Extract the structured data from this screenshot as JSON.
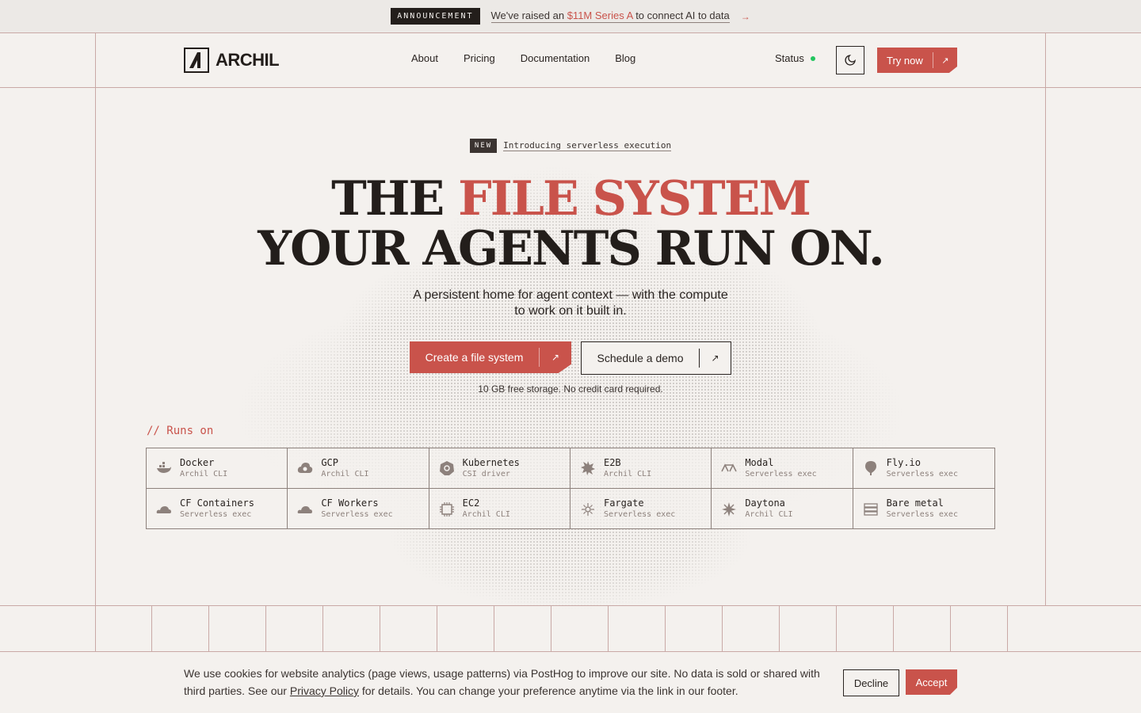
{
  "announcement": {
    "tag": "ANNOUNCEMENT",
    "pre": "We've raised an ",
    "highlight": "$11M Series A",
    "post": " to connect AI to data",
    "arrow": "→"
  },
  "brand": {
    "name": "ARCHIL"
  },
  "nav": {
    "items": [
      {
        "label": "About"
      },
      {
        "label": "Pricing"
      },
      {
        "label": "Documentation"
      },
      {
        "label": "Blog"
      }
    ],
    "status_label": "Status",
    "try_label": "Try now",
    "arrow": "↗"
  },
  "hero": {
    "new_tag": "NEW",
    "new_text": "Introducing serverless execution",
    "line1_pre": "THE ",
    "line1_red": "FILE SYSTEM",
    "line2": "YOUR AGENTS RUN ON.",
    "sub1": "A persistent home for agent context — with the compute",
    "sub2": "to work on it built in.",
    "cta_primary": "Create a file system",
    "cta_secondary": "Schedule a demo",
    "arrow": "↗",
    "free_note": "10 GB free storage. No credit card required."
  },
  "runs_on": {
    "label": "// Runs on",
    "items": [
      {
        "name": "Docker",
        "desc": "Archil CLI",
        "icon": "docker-icon"
      },
      {
        "name": "GCP",
        "desc": "Archil CLI",
        "icon": "cloud-icon"
      },
      {
        "name": "Kubernetes",
        "desc": "CSI driver",
        "icon": "kubernetes-icon"
      },
      {
        "name": "E2B",
        "desc": "Archil CLI",
        "icon": "e2b-icon"
      },
      {
        "name": "Modal",
        "desc": "Serverless exec",
        "icon": "modal-icon"
      },
      {
        "name": "Fly.io",
        "desc": "Serverless exec",
        "icon": "balloon-icon"
      },
      {
        "name": "CF Containers",
        "desc": "Serverless exec",
        "icon": "cloudflare-icon"
      },
      {
        "name": "CF Workers",
        "desc": "Serverless exec",
        "icon": "cloudflare-icon"
      },
      {
        "name": "EC2",
        "desc": "Archil CLI",
        "icon": "chip-icon"
      },
      {
        "name": "Fargate",
        "desc": "Serverless exec",
        "icon": "fargate-icon"
      },
      {
        "name": "Daytona",
        "desc": "Archil CLI",
        "icon": "daytona-icon"
      },
      {
        "name": "Bare metal",
        "desc": "Serverless exec",
        "icon": "server-icon"
      }
    ]
  },
  "cookie": {
    "text1": "We use cookies for website analytics (page views, usage patterns) via PostHog to improve our site. No data is sold or shared with third parties. See our ",
    "link": "Privacy Policy",
    "text2": " for details. You can change your preference anytime via the link in our footer.",
    "decline": "Decline",
    "accept": "Accept"
  },
  "colors": {
    "accent": "#c9534b",
    "background": "#f4f1ee",
    "ink": "#231e1b",
    "status_ok": "#22c55e"
  }
}
